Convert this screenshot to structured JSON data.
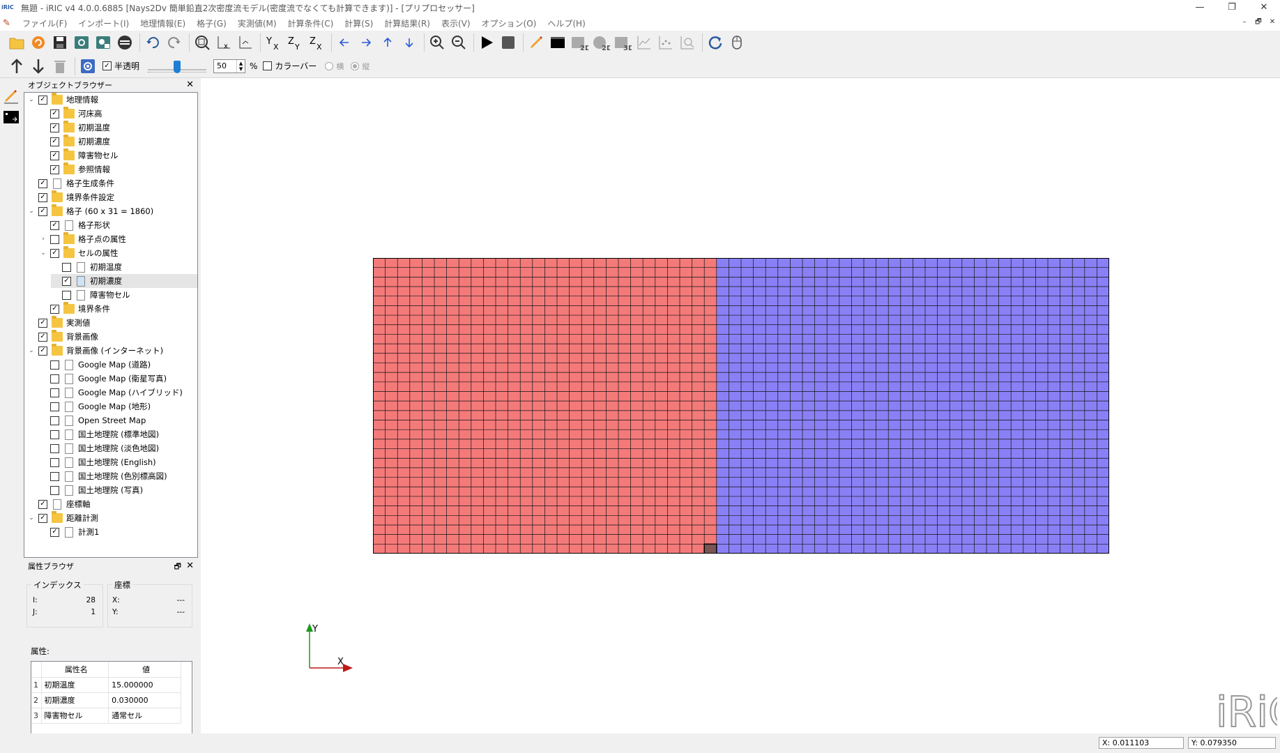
{
  "window": {
    "title": "無題 - iRIC v4 4.0.0.6885 [Nays2Dv 簡単鉛直2次密度流モデル(密度流でなくても計算できます)] - [プリプロセッサー]",
    "app_icon": "iRIC",
    "controls": [
      "—",
      "❐",
      "✕"
    ]
  },
  "menubar": {
    "items": [
      "ファイル(F)",
      "インポート(I)",
      "地理情報(E)",
      "格子(G)",
      "実測値(M)",
      "計算条件(C)",
      "計算(S)",
      "計算結果(R)",
      "表示(V)",
      "オプション(O)",
      "ヘルプ(H)"
    ],
    "mdi_controls": [
      "–",
      "🗗",
      "✕"
    ]
  },
  "toolbar2": {
    "semi_transparent_label": "半透明",
    "semi_transparent_checked": true,
    "opacity_value": "50",
    "opacity_unit": "%",
    "colorbar_label": "カラーバー",
    "colorbar_checked": false,
    "orientation_horizontal": "横",
    "orientation_vertical": "縦",
    "orientation_selected": "縦"
  },
  "object_browser": {
    "title": "オブジェクトブラウザー",
    "close": "✕",
    "items": [
      {
        "label": "地理情報",
        "level": 0,
        "expand": "open",
        "checked": true,
        "icon": "folder"
      },
      {
        "label": "河床高",
        "level": 1,
        "expand": "none",
        "checked": true,
        "icon": "folder"
      },
      {
        "label": "初期温度",
        "level": 1,
        "expand": "none",
        "checked": true,
        "icon": "folder"
      },
      {
        "label": "初期濃度",
        "level": 1,
        "expand": "none",
        "checked": true,
        "icon": "folder"
      },
      {
        "label": "障害物セル",
        "level": 1,
        "expand": "none",
        "checked": true,
        "icon": "folder"
      },
      {
        "label": "参照情報",
        "level": 1,
        "expand": "none",
        "checked": true,
        "icon": "folder"
      },
      {
        "label": "格子生成条件",
        "level": 0,
        "expand": "none",
        "checked": true,
        "icon": "file"
      },
      {
        "label": "境界条件設定",
        "level": 0,
        "expand": "none",
        "checked": true,
        "icon": "folder"
      },
      {
        "label": "格子 (60 x 31 = 1860)",
        "level": 0,
        "expand": "open",
        "checked": true,
        "icon": "folder"
      },
      {
        "label": "格子形状",
        "level": 1,
        "expand": "none",
        "checked": true,
        "icon": "file"
      },
      {
        "label": "格子点の属性",
        "level": 1,
        "expand": "closed",
        "checked": false,
        "icon": "folder"
      },
      {
        "label": "セルの属性",
        "level": 1,
        "expand": "open",
        "checked": true,
        "icon": "folder"
      },
      {
        "label": "初期温度",
        "level": 2,
        "expand": "none",
        "checked": false,
        "icon": "file"
      },
      {
        "label": "初期濃度",
        "level": 2,
        "expand": "none",
        "checked": true,
        "icon": "file-sel",
        "selected": true
      },
      {
        "label": "障害物セル",
        "level": 2,
        "expand": "none",
        "checked": false,
        "icon": "file"
      },
      {
        "label": "境界条件",
        "level": 1,
        "expand": "none",
        "checked": true,
        "icon": "folder"
      },
      {
        "label": "実測値",
        "level": 0,
        "expand": "none",
        "checked": true,
        "icon": "folder"
      },
      {
        "label": "背景画像",
        "level": 0,
        "expand": "none",
        "checked": true,
        "icon": "folder"
      },
      {
        "label": "背景画像 (インターネット)",
        "level": 0,
        "expand": "open",
        "checked": true,
        "icon": "folder"
      },
      {
        "label": "Google Map (道路)",
        "level": 1,
        "expand": "none",
        "checked": false,
        "icon": "file"
      },
      {
        "label": "Google Map (衛星写真)",
        "level": 1,
        "expand": "none",
        "checked": false,
        "icon": "file"
      },
      {
        "label": "Google Map (ハイブリッド)",
        "level": 1,
        "expand": "none",
        "checked": false,
        "icon": "file"
      },
      {
        "label": "Google Map (地形)",
        "level": 1,
        "expand": "none",
        "checked": false,
        "icon": "file"
      },
      {
        "label": "Open Street Map",
        "level": 1,
        "expand": "none",
        "checked": false,
        "icon": "file"
      },
      {
        "label": "国土地理院 (標準地図)",
        "level": 1,
        "expand": "none",
        "checked": false,
        "icon": "file"
      },
      {
        "label": "国土地理院 (淡色地図)",
        "level": 1,
        "expand": "none",
        "checked": false,
        "icon": "file"
      },
      {
        "label": "国土地理院 (English)",
        "level": 1,
        "expand": "none",
        "checked": false,
        "icon": "file"
      },
      {
        "label": "国土地理院 (色別標高図)",
        "level": 1,
        "expand": "none",
        "checked": false,
        "icon": "file"
      },
      {
        "label": "国土地理院 (写真)",
        "level": 1,
        "expand": "none",
        "checked": false,
        "icon": "file"
      },
      {
        "label": "座標軸",
        "level": 0,
        "expand": "none",
        "checked": true,
        "icon": "file"
      },
      {
        "label": "距離計測",
        "level": 0,
        "expand": "open",
        "checked": true,
        "icon": "folder"
      },
      {
        "label": "計測1",
        "level": 1,
        "expand": "none",
        "checked": true,
        "icon": "file"
      }
    ]
  },
  "property_browser": {
    "title": "属性ブラウザ",
    "float": "🗗",
    "close": "✕",
    "index_group": {
      "title": "インデックス",
      "i_label": "I:",
      "i_value": "28",
      "j_label": "J:",
      "j_value": "1"
    },
    "coord_group": {
      "title": "座標",
      "x_label": "X:",
      "x_value": "---",
      "y_label": "Y:",
      "y_value": "---"
    },
    "attributes_label": "属性:",
    "table_headers": [
      "属性名",
      "値"
    ],
    "rows": [
      {
        "n": "1",
        "name": "初期温度",
        "value": "15.000000"
      },
      {
        "n": "2",
        "name": "初期濃度",
        "value": "0.030000"
      },
      {
        "n": "3",
        "name": "障害物セル",
        "value": "通常セル"
      }
    ]
  },
  "canvas": {
    "grid_columns": 60,
    "grid_rows": 31,
    "left_region_columns": 28,
    "left_color": "#f47a7a",
    "right_color": "#8a80f5",
    "selected_cell_i": 28,
    "selected_cell_j": 1,
    "selected_color": "#7a5555",
    "axis_x_label": "X",
    "axis_y_label": "Y",
    "logo_text": "iRiC"
  },
  "statusbar": {
    "x": "X: 0.011103",
    "y": "Y: 0.079350"
  }
}
